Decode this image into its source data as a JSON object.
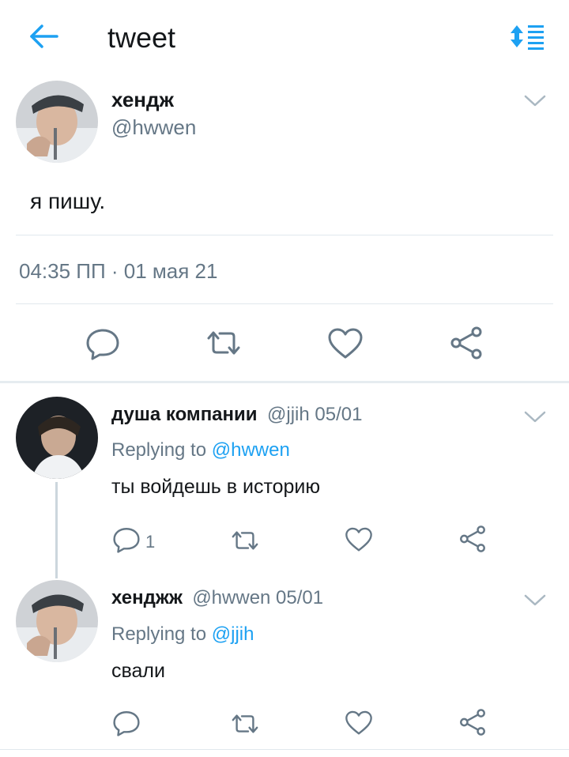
{
  "header": {
    "title": "tweet",
    "back_icon": "back-arrow-icon",
    "sort_icon": "sort-icon",
    "accent": "#1da1f2"
  },
  "main_tweet": {
    "name": "хендж​",
    "handle": "@hwwen",
    "text": "я пишу.",
    "timestamp": "04:35 ПП · 01 мая 21"
  },
  "replies": [
    {
      "name": "душа компании",
      "meta": "@jjih 05/01",
      "replying_prefix": "Replying to",
      "replying_to": "@hwwen",
      "text": "ты войдешь в историю",
      "reply_count": "1"
    },
    {
      "name": "хенджж",
      "meta": "@hwwen 05/01",
      "replying_prefix": "Replying to",
      "replying_to": "@jjih",
      "text": "свали",
      "reply_count": ""
    }
  ],
  "colors": {
    "text": "#14171a",
    "secondary": "#657786",
    "divider": "#e1e8ed",
    "accent": "#1da1f2"
  }
}
